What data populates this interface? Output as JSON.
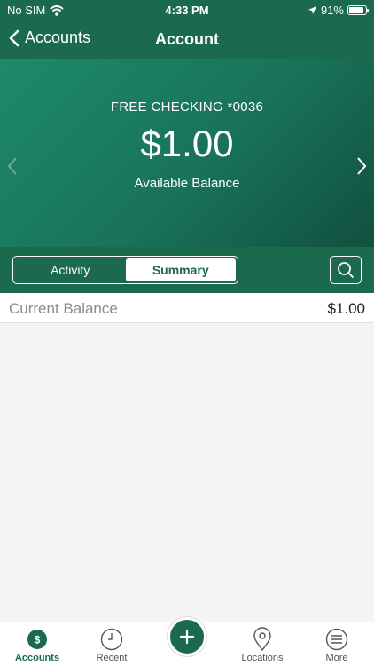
{
  "status_bar": {
    "carrier": "No SIM",
    "time": "4:33 PM",
    "battery": "91%",
    "battery_level": 0.91
  },
  "nav": {
    "back_label": "Accounts",
    "title": "Account"
  },
  "account": {
    "name": "FREE CHECKING *0036",
    "balance": "$1.00",
    "balance_label": "Available Balance"
  },
  "segments": {
    "activity": "Activity",
    "summary": "Summary",
    "selected": "Summary"
  },
  "summary_rows": [
    {
      "label": "Current Balance",
      "value": "$1.00"
    }
  ],
  "tabs": {
    "accounts": "Accounts",
    "recent": "Recent",
    "locations": "Locations",
    "more": "More"
  },
  "colors": {
    "brand": "#1c6a4e",
    "hero_start": "#1d8a68",
    "hero_end": "#11503f"
  }
}
